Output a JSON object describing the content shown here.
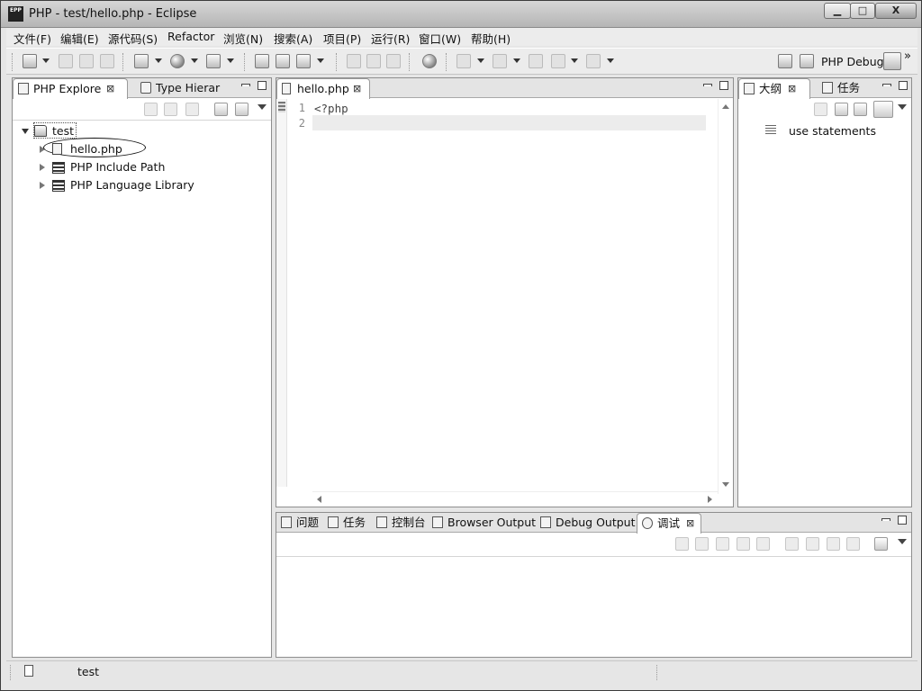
{
  "window": {
    "app_icon_text": "EPP",
    "title": "PHP  -  test/hello.php  -  Eclipse",
    "controls": {
      "minimize": "▁",
      "maximize": "□",
      "close": "X"
    }
  },
  "menu": {
    "items": [
      {
        "label": "文件(F)"
      },
      {
        "label": "编辑(E)"
      },
      {
        "label": "源代码(S)"
      },
      {
        "label": "Refactor"
      },
      {
        "label": "浏览(N)"
      },
      {
        "label": "搜索(A)"
      },
      {
        "label": "项目(P)"
      },
      {
        "label": "运行(R)"
      },
      {
        "label": "窗口(W)"
      },
      {
        "label": "帮助(H)"
      }
    ]
  },
  "toolbar": {
    "perspective": {
      "label": "PHP Debug",
      "more": "»"
    }
  },
  "explorer": {
    "tabs": [
      {
        "label": "PHP Explore",
        "close": "⊠"
      },
      {
        "label": "Type Hierar"
      }
    ],
    "tree": {
      "project": "test",
      "items": [
        {
          "label": "hello.php"
        },
        {
          "label": "PHP Include Path"
        },
        {
          "label": "PHP Language Library"
        }
      ]
    }
  },
  "editor": {
    "tab": {
      "label": "hello.php",
      "close": "⊠"
    },
    "line_numbers": [
      "1",
      "2"
    ],
    "lines": [
      "<?php",
      ""
    ]
  },
  "outline": {
    "tabs": [
      {
        "label": "大纲",
        "close": "⊠"
      },
      {
        "label": "任务"
      }
    ],
    "items": [
      {
        "label": "use statements"
      }
    ]
  },
  "bottom": {
    "tabs": [
      {
        "label": "问题"
      },
      {
        "label": "任务"
      },
      {
        "label": "控制台"
      },
      {
        "label": "Browser Output"
      },
      {
        "label": "Debug Output"
      },
      {
        "label": "调试",
        "close": "⊠"
      }
    ]
  },
  "statusbar": {
    "text": "test"
  }
}
